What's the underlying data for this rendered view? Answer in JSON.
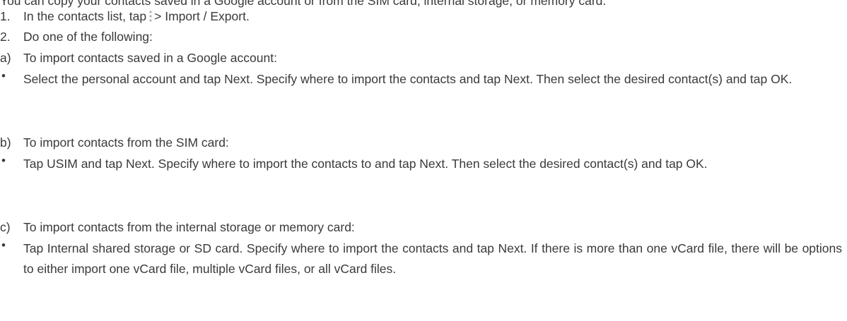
{
  "lead_text": "You can copy your contacts saved in a Google account or from the SIM card, internal storage, or memory card.",
  "steps": [
    {
      "marker": "1.",
      "text_before_icon": "In the contacts list, tap",
      "icon": "more-options-icon",
      "text_after_icon": "> Import / Export."
    },
    {
      "marker": "2.",
      "text": "Do one of the following:"
    }
  ],
  "options": [
    {
      "marker": "a)",
      "heading": "To import contacts saved in a Google account:",
      "bullet": "•",
      "detail": "Select the personal account and tap Next. Specify where to import the contacts and tap Next. Then select the desired contact(s) and tap OK."
    },
    {
      "marker": "b)",
      "heading": "To import contacts from the SIM card:",
      "bullet": "•",
      "detail": "Tap USIM and tap Next. Specify where to import the contacts to and tap Next. Then select the desired contact(s) and tap OK."
    },
    {
      "marker": "c)",
      "heading": "To import contacts from the internal storage or memory card:",
      "bullet": "•",
      "detail": "Tap Internal shared storage or SD card. Specify where to import the contacts and tap Next. If there is more than one vCard file, there will be options to either import one vCard file, multiple vCard files, or all vCard files."
    }
  ],
  "colors": {
    "text": "#3a3a3a",
    "icon": "#b9b9b9",
    "background": "#ffffff"
  }
}
